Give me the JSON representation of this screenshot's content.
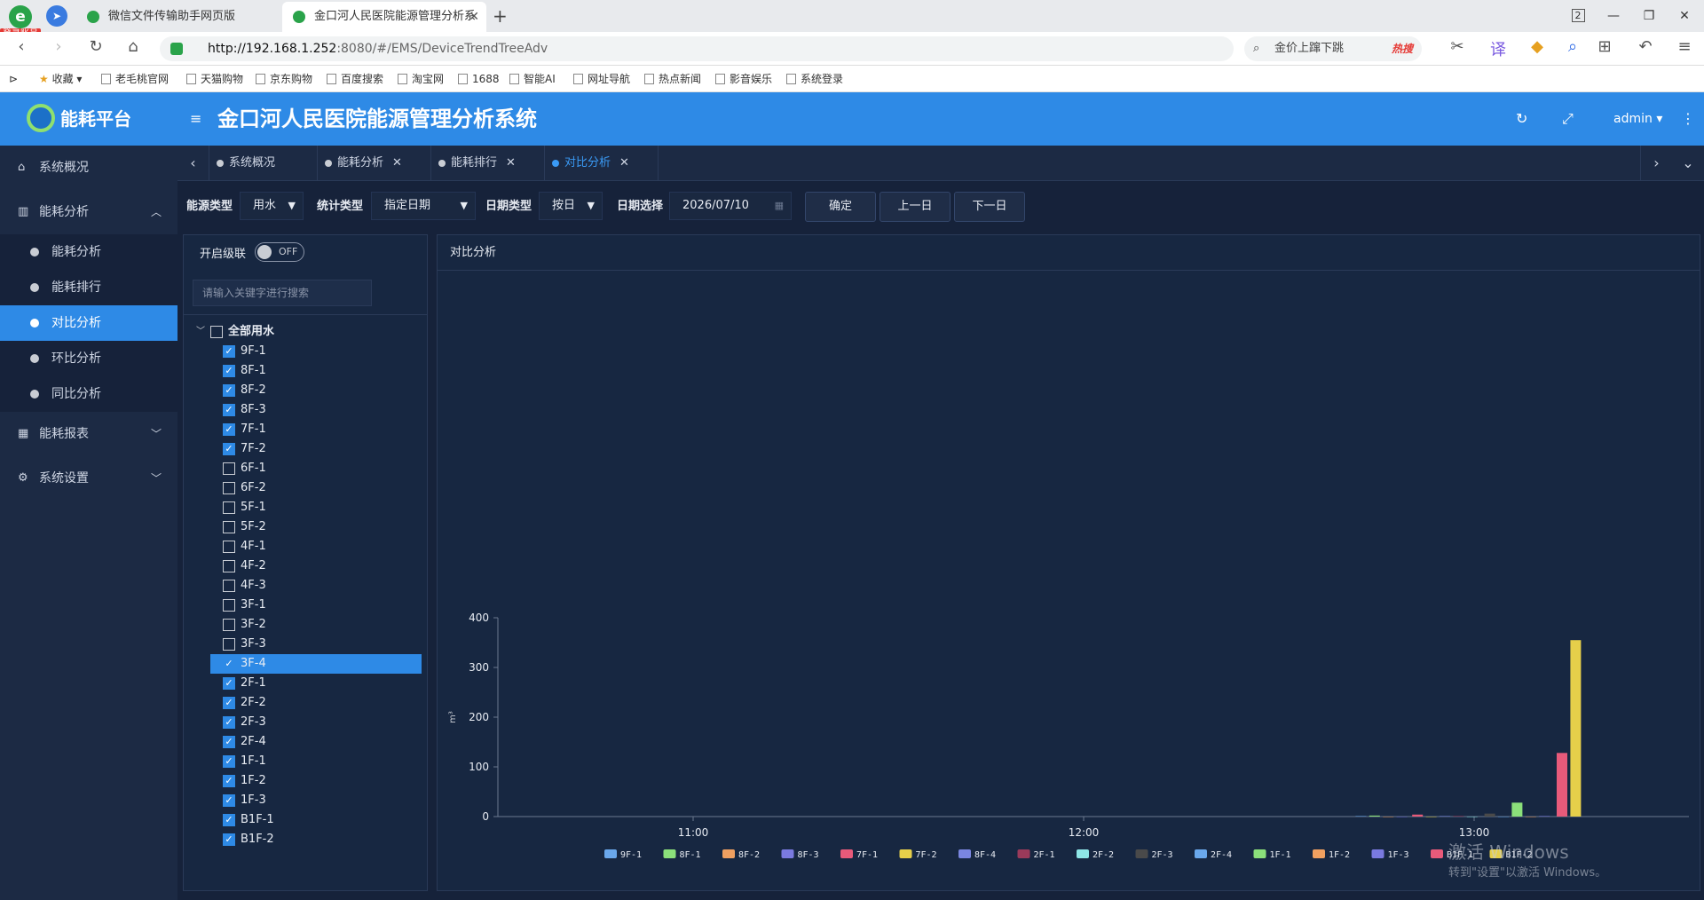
{
  "browser": {
    "login_badge": "登录账号",
    "tabs": [
      {
        "label": "微信文件传输助手网页版",
        "active": false
      },
      {
        "label": "金口河人民医院能源管理分析系",
        "active": true
      }
    ],
    "tab_count": "2",
    "url_host": "http://192.168.1.252",
    "url_path": ":8080/#/EMS/DeviceTrendTreeAdv",
    "search_text": "金价上蹿下跳",
    "search_hot": "热搜",
    "bookmarks": [
      "收藏",
      "老毛桃官网",
      "天猫购物",
      "京东购物",
      "百度搜索",
      "淘宝网",
      "1688",
      "智能AI",
      "网址导航",
      "热点新闻",
      "影音娱乐",
      "系统登录"
    ]
  },
  "app": {
    "brand": "能耗平台",
    "title": "金口河人民医院能源管理分析系统",
    "user": "admin"
  },
  "sidebar": {
    "items": [
      {
        "label": "系统概况",
        "icon": "home-icon"
      },
      {
        "label": "能耗分析",
        "icon": "bar-chart-icon",
        "chev": "︿"
      },
      {
        "label": "能耗报表",
        "icon": "table-icon",
        "chev": "﹀"
      },
      {
        "label": "系统设置",
        "icon": "gear-icon",
        "chev": "﹀"
      }
    ],
    "sub": [
      "能耗分析",
      "能耗排行",
      "对比分析",
      "环比分析",
      "同比分析"
    ]
  },
  "pagetabs": [
    {
      "label": "系统概况",
      "closable": false
    },
    {
      "label": "能耗分析",
      "closable": true
    },
    {
      "label": "能耗排行",
      "closable": true
    },
    {
      "label": "对比分析",
      "closable": true,
      "active": true
    }
  ],
  "filters": {
    "energy_label": "能源类型",
    "energy_value": "用水",
    "stat_label": "统计类型",
    "stat_value": "指定日期",
    "date_type_label": "日期类型",
    "date_type_value": "按日",
    "date_label": "日期选择",
    "date_value": "2026/07/10",
    "confirm": "确定",
    "prev": "上一日",
    "next": "下一日"
  },
  "tree": {
    "cascade_label": "开启级联",
    "toggle": "OFF",
    "search_placeholder": "请输入关键字进行搜索",
    "root": "全部用水",
    "nodes": [
      {
        "label": "9F-1",
        "checked": true
      },
      {
        "label": "8F-1",
        "checked": true
      },
      {
        "label": "8F-2",
        "checked": true
      },
      {
        "label": "8F-3",
        "checked": true
      },
      {
        "label": "7F-1",
        "checked": true
      },
      {
        "label": "7F-2",
        "checked": true
      },
      {
        "label": "6F-1",
        "checked": false
      },
      {
        "label": "6F-2",
        "checked": false
      },
      {
        "label": "5F-1",
        "checked": false
      },
      {
        "label": "5F-2",
        "checked": false
      },
      {
        "label": "4F-1",
        "checked": false
      },
      {
        "label": "4F-2",
        "checked": false
      },
      {
        "label": "4F-3",
        "checked": false
      },
      {
        "label": "3F-1",
        "checked": false
      },
      {
        "label": "3F-2",
        "checked": false
      },
      {
        "label": "3F-3",
        "checked": false
      },
      {
        "label": "3F-4",
        "checked": true,
        "selected": true
      },
      {
        "label": "2F-1",
        "checked": true
      },
      {
        "label": "2F-2",
        "checked": true
      },
      {
        "label": "2F-3",
        "checked": true
      },
      {
        "label": "2F-4",
        "checked": true
      },
      {
        "label": "1F-1",
        "checked": true
      },
      {
        "label": "1F-2",
        "checked": true
      },
      {
        "label": "1F-3",
        "checked": true
      },
      {
        "label": "B1F-1",
        "checked": true
      },
      {
        "label": "B1F-2",
        "checked": true
      }
    ]
  },
  "chart_panel_title": "对比分析",
  "chart_data": {
    "type": "bar",
    "ylabel": "m³",
    "ylim": [
      0,
      400
    ],
    "yticks": [
      0,
      100,
      200,
      300,
      400
    ],
    "xticks": [
      "11:00",
      "12:00",
      "13:00"
    ],
    "x_range_hours": [
      10.5,
      13.55
    ],
    "group_time": "13:00",
    "series": [
      {
        "name": "9F-1",
        "color": "#6aa8ec",
        "time": 12.71,
        "value": 1
      },
      {
        "name": "8F-1",
        "color": "#8be07a",
        "time": 12.745,
        "value": 2
      },
      {
        "name": "8F-2",
        "color": "#f0a060",
        "time": 12.78,
        "value": 0
      },
      {
        "name": "8F-3",
        "color": "#7a7ae0",
        "time": 12.815,
        "value": 0
      },
      {
        "name": "7F-1",
        "color": "#e85a7a",
        "time": 12.855,
        "value": 4
      },
      {
        "name": "7F-2",
        "color": "#e6cf4a",
        "time": 12.89,
        "value": 0
      },
      {
        "name": "8F-4",
        "color": "#7a86e0",
        "time": 12.925,
        "value": 1
      },
      {
        "name": "2F-1",
        "color": "#9a3a5a",
        "time": 12.96,
        "value": 1
      },
      {
        "name": "2F-2",
        "color": "#8ee6e6",
        "time": 12.995,
        "value": 0
      },
      {
        "name": "2F-3",
        "color": "#4a4a4a",
        "time": 13.04,
        "value": 6
      },
      {
        "name": "2F-4",
        "color": "#6aa8ec",
        "time": 13.075,
        "value": 0
      },
      {
        "name": "1F-1",
        "color": "#8be07a",
        "time": 13.11,
        "value": 28
      },
      {
        "name": "1F-2",
        "color": "#f0a060",
        "time": 13.145,
        "value": 0
      },
      {
        "name": "1F-3",
        "color": "#7a7ae0",
        "time": 13.18,
        "value": 1
      },
      {
        "name": "B1F-1",
        "color": "#e85a7a",
        "time": 13.225,
        "value": 128
      },
      {
        "name": "B1F-2",
        "color": "#e6cf4a",
        "time": 13.26,
        "value": 355
      }
    ]
  },
  "watermark": {
    "line1": "激活 Windows",
    "line2": "转到\"设置\"以激活 Windows。"
  }
}
